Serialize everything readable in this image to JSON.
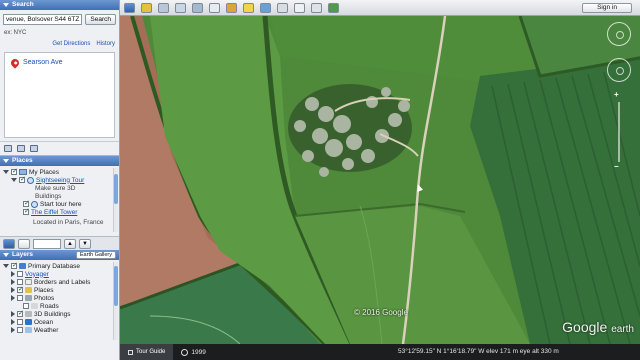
{
  "sidebar": {
    "search": {
      "header": "Search",
      "input_value": "venue, Bolsover S44 6TZ",
      "button": "Search",
      "hint": "ex: NYC",
      "links": [
        "Get Directions",
        "History"
      ],
      "result": "Searson Ave"
    },
    "places": {
      "header": "Places",
      "items": [
        {
          "label": "My Places"
        },
        {
          "label": "Sightseeing Tour"
        },
        {
          "label": "Make sure 3D"
        },
        {
          "label": "Buildings"
        },
        {
          "label": "Start tour here"
        },
        {
          "label": "The Eiffel Tower"
        },
        {
          "label": "Located in Paris, France"
        }
      ]
    },
    "layers": {
      "header": "Layers",
      "gallery_button": "Earth Gallery",
      "items": [
        {
          "label": "Primary Database"
        },
        {
          "label": "Voyager"
        },
        {
          "label": "Borders and Labels"
        },
        {
          "label": "Places"
        },
        {
          "label": "Photos"
        },
        {
          "label": "Roads"
        },
        {
          "label": "3D Buildings"
        },
        {
          "label": "Ocean"
        },
        {
          "label": "Weather"
        }
      ]
    }
  },
  "toolbar": {
    "signin": "Sign in",
    "icon_names": [
      "sidebar-toggle-icon",
      "add-placemark-icon",
      "add-polygon-icon",
      "add-path-icon",
      "add-overlay-icon",
      "record-tour-icon",
      "historical-imagery-icon",
      "sunlight-icon",
      "planets-icon",
      "ruler-icon",
      "email-icon",
      "print-icon",
      "maps-icon"
    ]
  },
  "map": {
    "copyright": "© 2016 Google",
    "logo_main": "Google",
    "logo_sub": "earth"
  },
  "status": {
    "tour_guide": "Tour Guide",
    "year": "1999",
    "coords": "53°12'59.15\" N   1°16'18.79\" W   elev   171 m      eye alt   330 m"
  },
  "colors": {
    "panel_header": "#4d7fc4",
    "link": "#1a4fb5",
    "status_bg": "#1b1d1f"
  }
}
